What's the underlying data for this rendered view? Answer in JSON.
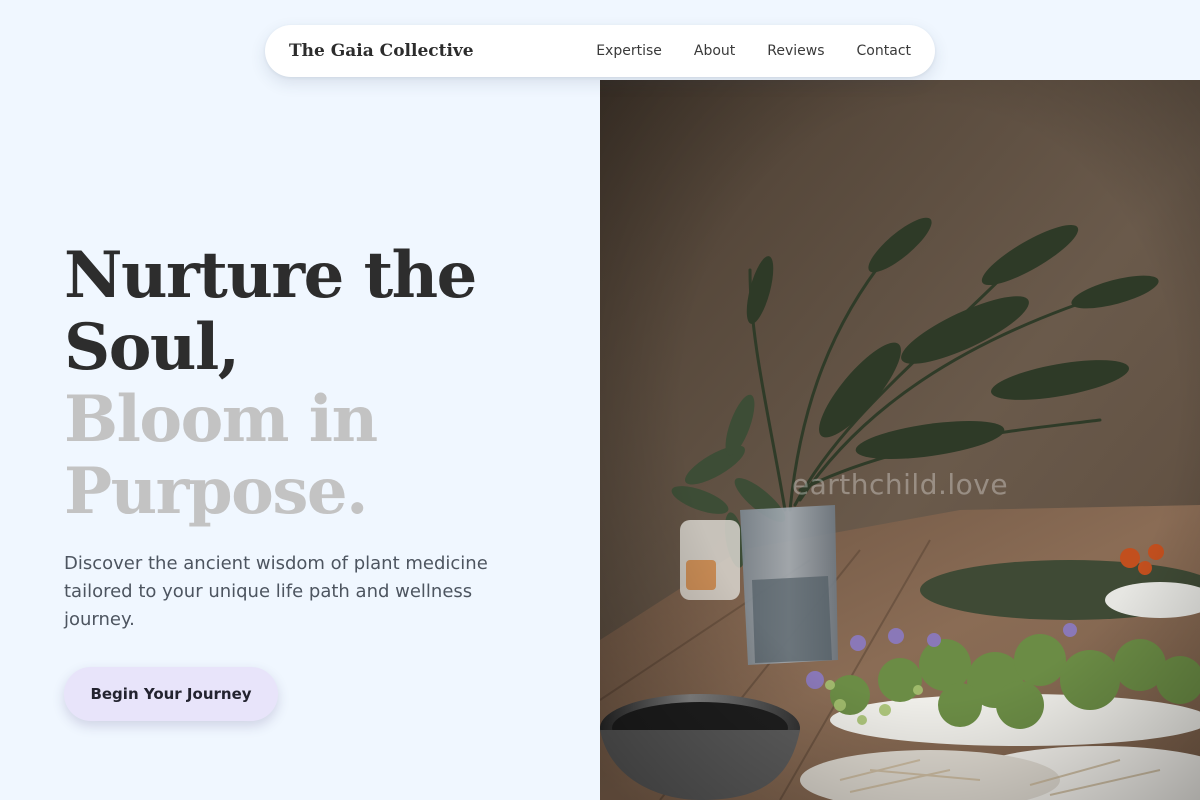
{
  "nav": {
    "brand": "The Gaia Collective",
    "links": [
      "Expertise",
      "About",
      "Reviews",
      "Contact"
    ]
  },
  "hero": {
    "headline_dark_1": "Nurture the",
    "headline_dark_2": "Soul,",
    "headline_light_1": "Bloom in",
    "headline_light_2": "Purpose.",
    "description": "Discover the ancient wisdom of plant medicine tailored to your unique life path and wellness journey.",
    "cta_label": "Begin Your Journey"
  },
  "photo": {
    "watermark": "earthchild.love",
    "alt": "Herbs and plants arranged on a wooden table"
  },
  "colors": {
    "background": "#f0f7ff",
    "headline_dark": "#2d2d2d",
    "headline_light": "#c3c3c3",
    "cta_background": "#e8e4fa"
  }
}
